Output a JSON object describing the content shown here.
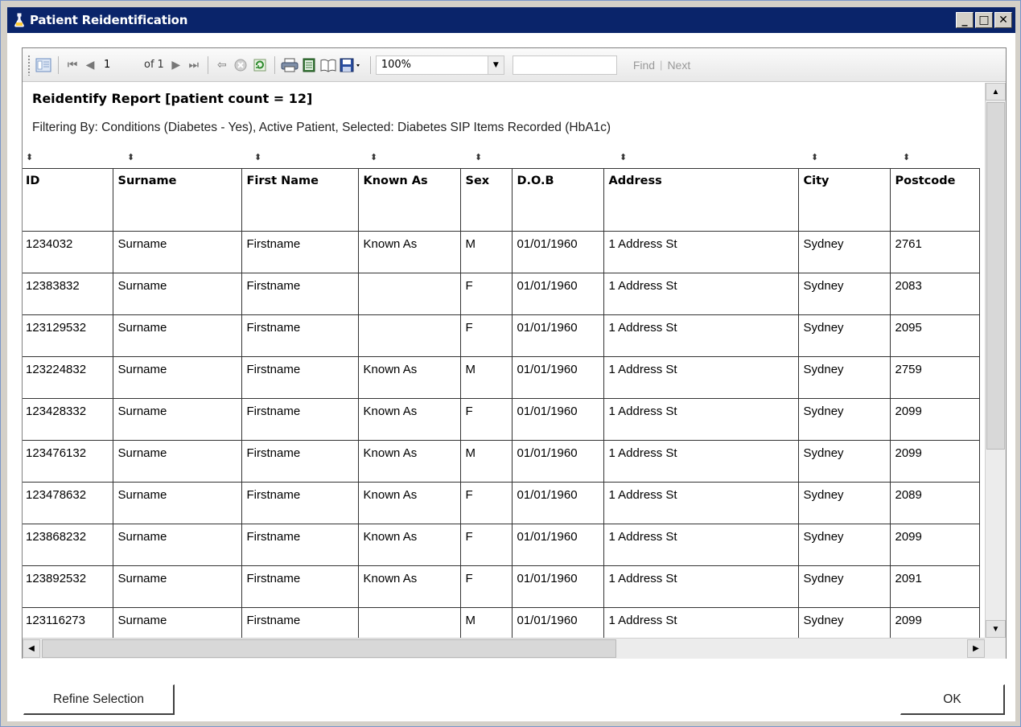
{
  "window": {
    "title": "Patient Reidentification"
  },
  "titlebar_buttons": {
    "minimize": "_",
    "maximize": "□",
    "close": "✕"
  },
  "toolbar": {
    "page_current": "1",
    "page_of_label": "of",
    "page_total": "1",
    "zoom": "100%",
    "find_label": "Find",
    "separator": "|",
    "next_label": "Next"
  },
  "report": {
    "title": "Reidentify Report  [patient count = 12]",
    "filter_text": "Filtering By: Conditions (Diabetes - Yes), Active Patient, Selected: Diabetes SIP Items Recorded (HbA1c)",
    "columns": [
      "ID",
      "Surname",
      "First Name",
      "Known As",
      "Sex",
      "D.O.B",
      "Address",
      "City",
      "Postcode"
    ],
    "rows": [
      [
        "1234032",
        "Surname",
        "Firstname",
        "Known As",
        "M",
        "01/01/1960",
        "1 Address St",
        "Sydney",
        "2761"
      ],
      [
        "12383832",
        "Surname",
        "Firstname",
        "",
        "F",
        "01/01/1960",
        "1 Address St",
        "Sydney",
        "2083"
      ],
      [
        "123129532",
        "Surname",
        "Firstname",
        "",
        "F",
        "01/01/1960",
        "1 Address St",
        "Sydney",
        "2095"
      ],
      [
        "123224832",
        "Surname",
        "Firstname",
        "Known As",
        "M",
        "01/01/1960",
        "1 Address St",
        "Sydney",
        "2759"
      ],
      [
        "123428332",
        "Surname",
        "Firstname",
        "Known As",
        "F",
        "01/01/1960",
        "1 Address St",
        "Sydney",
        "2099"
      ],
      [
        "123476132",
        "Surname",
        "Firstname",
        "Known As",
        "M",
        "01/01/1960",
        "1 Address St",
        "Sydney",
        "2099"
      ],
      [
        "123478632",
        "Surname",
        "Firstname",
        "Known As",
        "F",
        "01/01/1960",
        "1 Address St",
        "Sydney",
        "2089"
      ],
      [
        "123868232",
        "Surname",
        "Firstname",
        "Known As",
        "F",
        "01/01/1960",
        "1 Address St",
        "Sydney",
        "2099"
      ],
      [
        "123892532",
        "Surname",
        "Firstname",
        "Known As",
        "F",
        "01/01/1960",
        "1 Address St",
        "Sydney",
        "2091"
      ],
      [
        "123116273",
        "Surname",
        "Firstname",
        "",
        "M",
        "01/01/1960",
        "1 Address St",
        "Sydney",
        "2099"
      ]
    ]
  },
  "buttons": {
    "refine": "Refine Selection",
    "ok": "OK"
  },
  "colors": {
    "titlebar": "#0a246a",
    "frame": "#d4d0c8",
    "grid_line": "#333333"
  }
}
